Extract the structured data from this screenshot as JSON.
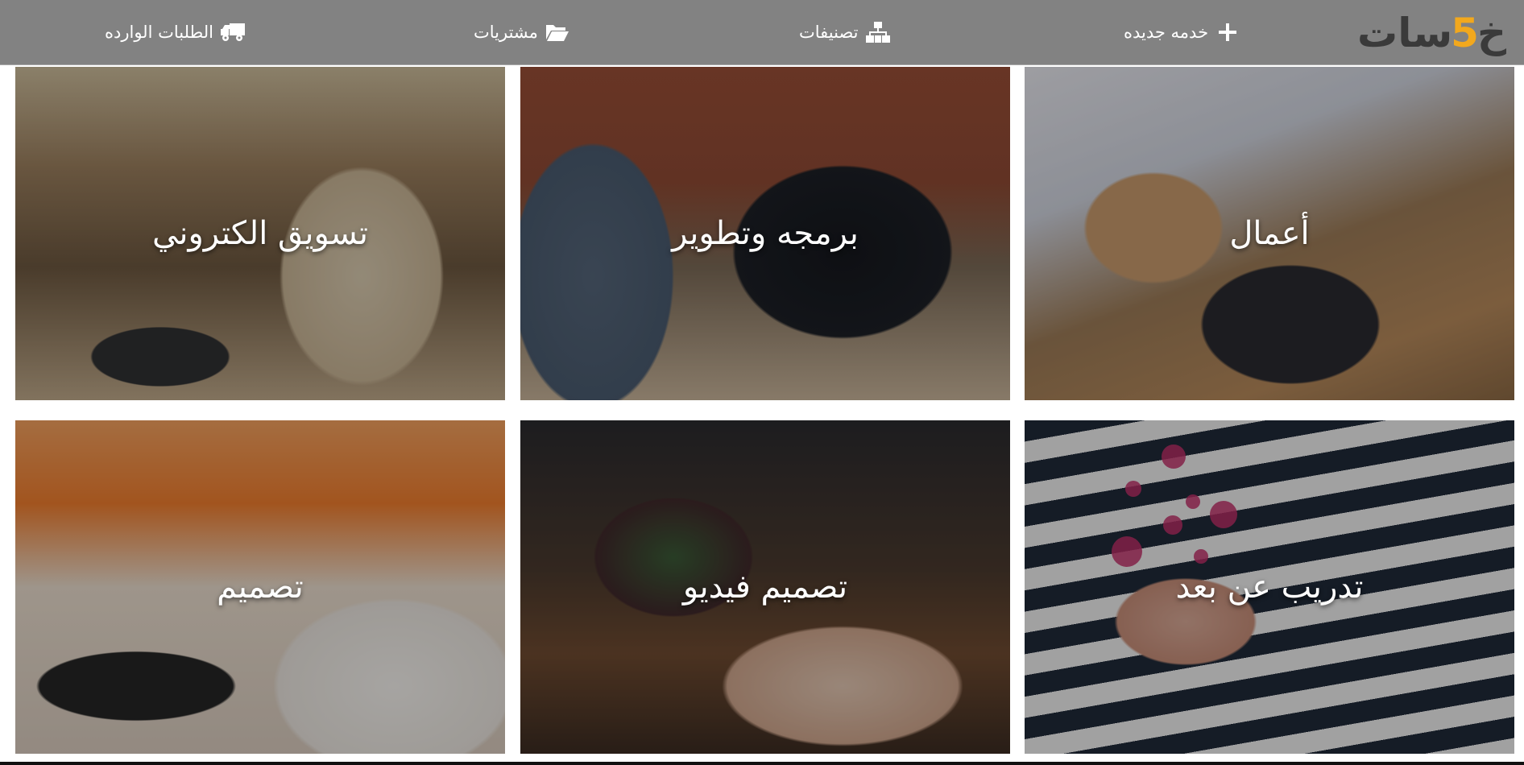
{
  "logo": {
    "word": "خمسات",
    "digit": "5",
    "prefix": "خ",
    "suffix": "سات"
  },
  "nav": {
    "new_service": "خدمه جديده",
    "categories": "تصنيفات",
    "purchases": "مشتريات",
    "incoming_orders": "الطلبات الوارده"
  },
  "icons": {
    "new_service": "plus-icon",
    "categories": "sitemap-icon",
    "purchases": "folder-open-icon",
    "incoming_orders": "truck-icon"
  },
  "colors": {
    "navbar_bg": "#828282",
    "logo_dark": "#3a3a3a",
    "logo_accent": "#f2a81d",
    "text_light": "#ffffff"
  },
  "tiles": [
    {
      "title": "أعمال",
      "image": "business-photo"
    },
    {
      "title": "برمجه وتطوير",
      "image": "programming-photo"
    },
    {
      "title": "تسويق الكتروني",
      "image": "marketing-photo"
    },
    {
      "title": "تدريب عن بعد",
      "image": "training-photo"
    },
    {
      "title": "تصميم فيديو",
      "image": "video-design-photo"
    },
    {
      "title": "تصميم",
      "image": "design-photo"
    }
  ]
}
